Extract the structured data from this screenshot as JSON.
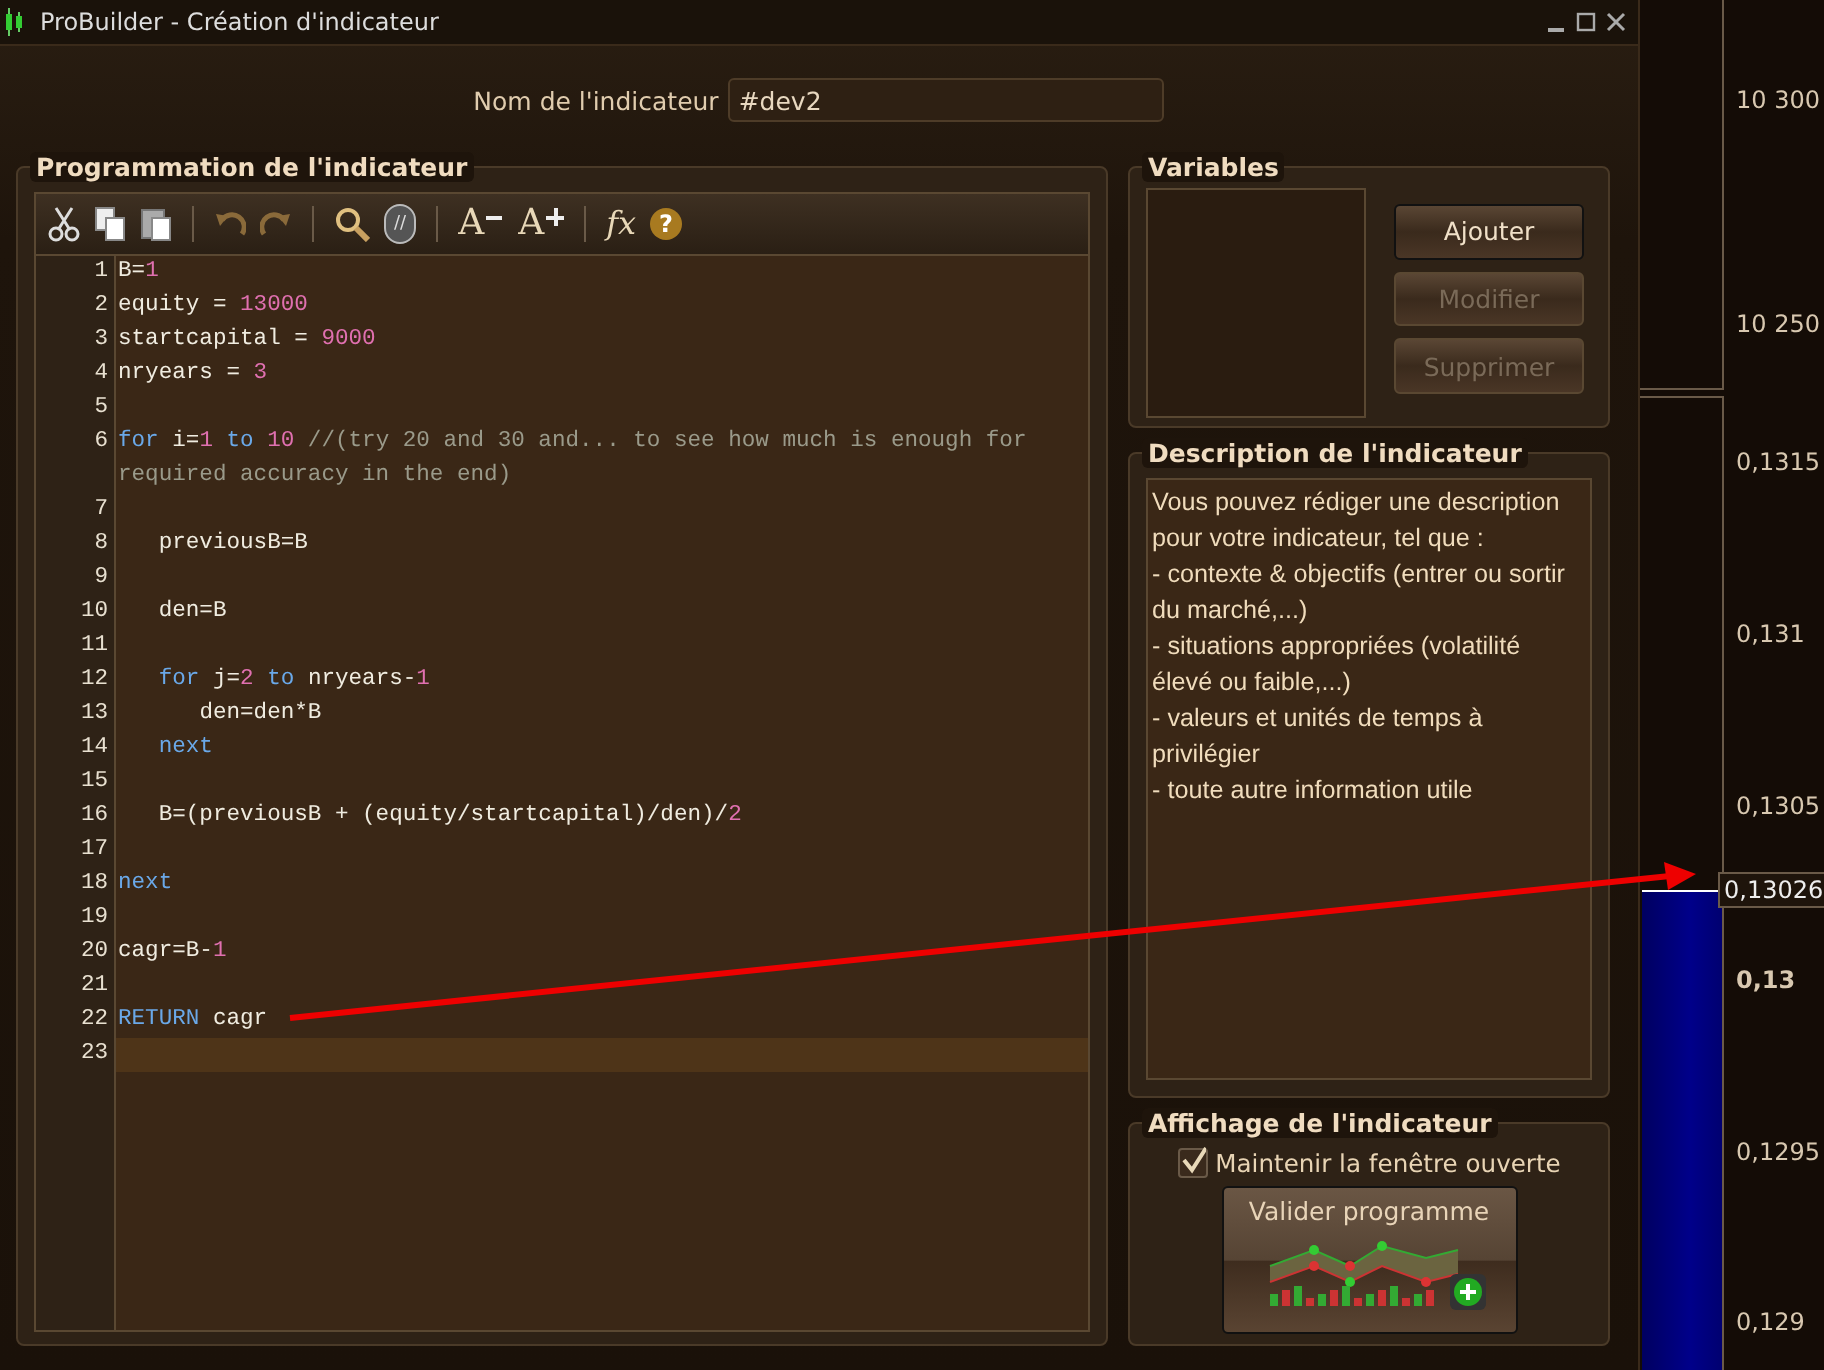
{
  "window": {
    "title": "ProBuilder - Création d'indicateur"
  },
  "name_field": {
    "label": "Nom de l'indicateur",
    "value": "#dev2"
  },
  "editor": {
    "title": "Programmation de l'indicateur",
    "toolbar": [
      {
        "kind": "cut"
      },
      {
        "kind": "copy"
      },
      {
        "kind": "paste"
      },
      {
        "kind": "separator"
      },
      {
        "kind": "undo"
      },
      {
        "kind": "redo"
      },
      {
        "kind": "separator"
      },
      {
        "kind": "search"
      },
      {
        "kind": "comment",
        "glyph": "//"
      },
      {
        "kind": "separator"
      },
      {
        "kind": "smaller",
        "glyph": "A"
      },
      {
        "kind": "larger",
        "glyph": "A"
      },
      {
        "kind": "separator"
      },
      {
        "kind": "function",
        "glyph": "fx"
      },
      {
        "kind": "help",
        "glyph": "?"
      }
    ],
    "lines": [
      {
        "number": "1",
        "current": false,
        "tokens": [
          {
            "kind": "text",
            "text": "B="
          },
          {
            "kind": "num",
            "text": "1"
          }
        ]
      },
      {
        "number": "2",
        "current": false,
        "tokens": [
          {
            "kind": "text",
            "text": "equity = "
          },
          {
            "kind": "num",
            "text": "13000"
          }
        ]
      },
      {
        "number": "3",
        "current": false,
        "tokens": [
          {
            "kind": "text",
            "text": "startcapital = "
          },
          {
            "kind": "num",
            "text": "9000"
          }
        ]
      },
      {
        "number": "4",
        "current": false,
        "tokens": [
          {
            "kind": "text",
            "text": "nryears = "
          },
          {
            "kind": "num",
            "text": "3"
          }
        ]
      },
      {
        "number": "5",
        "current": false
      },
      {
        "number": "6",
        "current": false,
        "tokens": [
          {
            "kind": "kw",
            "text": "for "
          },
          {
            "kind": "text",
            "text": "i="
          },
          {
            "kind": "num",
            "text": "1"
          },
          {
            "kind": "kw",
            "text": " to "
          },
          {
            "kind": "num",
            "text": "10"
          },
          {
            "kind": "comment",
            "text": " //(try 20 and 30 and... to see how much is enough for required accuracy in the end)"
          }
        ]
      },
      {
        "number": "7",
        "current": false
      },
      {
        "number": "8",
        "current": false,
        "tokens": [
          {
            "kind": "text",
            "text": "   previousB=B"
          }
        ]
      },
      {
        "number": "9",
        "current": false
      },
      {
        "number": "10",
        "current": false,
        "tokens": [
          {
            "kind": "text",
            "text": "   den=B"
          }
        ]
      },
      {
        "number": "11",
        "current": false
      },
      {
        "number": "12",
        "current": false,
        "tokens": [
          {
            "kind": "kw",
            "text": "   for "
          },
          {
            "kind": "text",
            "text": "j="
          },
          {
            "kind": "num",
            "text": "2"
          },
          {
            "kind": "kw",
            "text": " to "
          },
          {
            "kind": "text",
            "text": "nryears-"
          },
          {
            "kind": "num",
            "text": "1"
          }
        ]
      },
      {
        "number": "13",
        "current": false,
        "tokens": [
          {
            "kind": "text",
            "text": "      den=den*B"
          }
        ]
      },
      {
        "number": "14",
        "current": false,
        "tokens": [
          {
            "kind": "kw",
            "text": "   next"
          }
        ]
      },
      {
        "number": "15",
        "current": false
      },
      {
        "number": "16",
        "current": false,
        "tokens": [
          {
            "kind": "text",
            "text": "   B=(previousB + (equity/startcapital)/den)/"
          },
          {
            "kind": "num",
            "text": "2"
          }
        ]
      },
      {
        "number": "17",
        "current": false
      },
      {
        "number": "18",
        "current": false,
        "tokens": [
          {
            "kind": "kw",
            "text": "next"
          }
        ]
      },
      {
        "number": "19",
        "current": false
      },
      {
        "number": "20",
        "current": false,
        "tokens": [
          {
            "kind": "text",
            "text": "cagr=B-"
          },
          {
            "kind": "num",
            "text": "1"
          }
        ]
      },
      {
        "number": "21",
        "current": false
      },
      {
        "number": "22",
        "current": false,
        "tokens": [
          {
            "kind": "kw",
            "text": "RETURN"
          },
          {
            "kind": "text",
            "text": " cagr"
          }
        ]
      },
      {
        "number": "23",
        "current": true
      }
    ]
  },
  "variables": {
    "title": "Variables",
    "buttons": [
      {
        "label": "Ajouter",
        "disabled": false
      },
      {
        "label": "Modifier",
        "disabled": true
      },
      {
        "label": "Supprimer",
        "disabled": true
      }
    ]
  },
  "description": {
    "title": "Description de l'indicateur",
    "lines": [
      "Vous pouvez rédiger une description pour votre indicateur, tel que :",
      "- contexte & objectifs (entrer ou sortir du marché,...)",
      "- situations appropriées (volatilité élevé ou faible,...)",
      "- valeurs et unités de temps à privilégier",
      "- toute autre information utile"
    ]
  },
  "display": {
    "title": "Affichage de l'indicateur",
    "keep_open": {
      "label": "Maintenir la fenêtre ouverte",
      "checked": true
    },
    "validate_button": {
      "label": "Valider programme"
    }
  },
  "price_axis": [
    {
      "kind": "tick",
      "text": "10 300"
    },
    {
      "kind": "tick",
      "text": "10 250"
    },
    {
      "kind": "tick",
      "text": "0,1315"
    },
    {
      "kind": "tick",
      "text": "0,131"
    },
    {
      "kind": "tick",
      "text": "0,1305"
    },
    {
      "kind": "current",
      "text": "0,13026"
    },
    {
      "kind": "bold",
      "text": "0,13"
    },
    {
      "kind": "tick",
      "text": "0,1295"
    },
    {
      "kind": "tick",
      "text": "0,129"
    }
  ]
}
